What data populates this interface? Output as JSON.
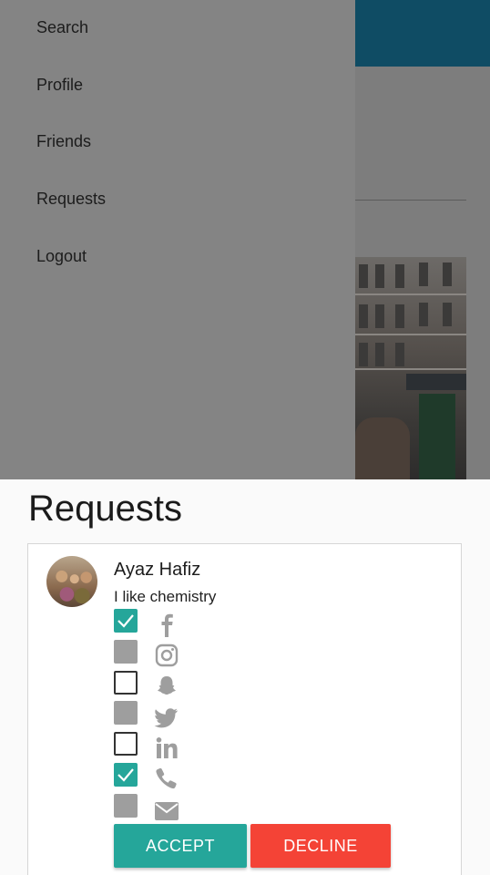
{
  "drawer": {
    "items": [
      {
        "label": "Search"
      },
      {
        "label": "Profile"
      },
      {
        "label": "Friends"
      },
      {
        "label": "Requests"
      },
      {
        "label": "Logout"
      }
    ]
  },
  "sheet": {
    "title": "Requests",
    "request": {
      "name": "Ayaz Hafiz",
      "bio": "I like chemistry",
      "socials": [
        {
          "icon": "facebook-icon",
          "state": "checked"
        },
        {
          "icon": "instagram-icon",
          "state": "filled"
        },
        {
          "icon": "snapchat-icon",
          "state": "unchecked"
        },
        {
          "icon": "twitter-icon",
          "state": "filled"
        },
        {
          "icon": "linkedin-icon",
          "state": "unchecked"
        },
        {
          "icon": "phone-icon",
          "state": "checked"
        },
        {
          "icon": "email-icon",
          "state": "filled"
        }
      ],
      "accept_label": "ACCEPT",
      "decline_label": "DECLINE"
    }
  },
  "colors": {
    "accent": "#25a69a",
    "decline": "#f44336",
    "topbar": "#0f4c64",
    "icon_grey": "#9e9e9e"
  }
}
